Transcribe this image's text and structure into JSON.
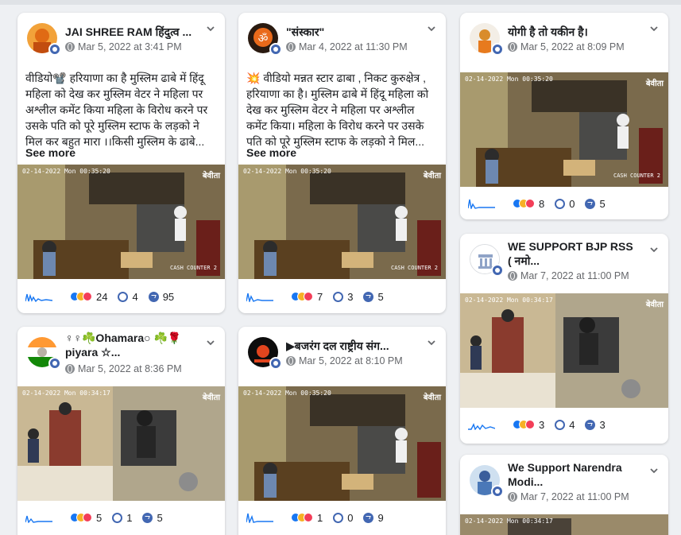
{
  "posts": [
    {
      "page_name": "JAI SHREE RAM हिंदुत्व ...",
      "date": "Mar 5, 2022 at 3:41 PM",
      "text": "वीडियो📽️ हरियाणा का है मुस्लिम ढाबे में हिंदू महिला को देख कर मुस्लिम वेटर ने महिला पर अश्लील कमेंट किया महिला के विरोध करने पर उसके पति को पूरे मुस्लिम स्टाफ के लड़को ने मिल कर बहुत मारा ।।किसी मुस्लिम के ढाबे...",
      "see_more": "See more",
      "video_timestamp": "02-14-2022 Mon 00:35:20",
      "video_watermark": "बेवीता",
      "video_counter": "CASH COUNTER 2",
      "reactions": "24",
      "comments": "4",
      "shares": "95"
    },
    {
      "page_name": "\"संस्कार\"",
      "date": "Mar 4, 2022 at 11:30 PM",
      "text": "💥 वीडियो मन्नत स्टार ढाबा , निकट कुरुक्षेत्र , हरियाणा का है। मुस्लिम ढाबे में हिंदू महिला को देख कर मुस्लिम वेटर ने महिला पर अश्लील कमेंट किया। महिला के विरोध करने पर उसके पति को पूरे मुस्लिम स्टाफ के लड़को ने मिल...",
      "see_more": "See more",
      "video_timestamp": "02-14-2022 Mon 00:35:20",
      "video_watermark": "बेवीता",
      "video_counter": "CASH COUNTER 2",
      "reactions": "7",
      "comments": "3",
      "shares": "5"
    },
    {
      "page_name": "योगी है तो यकीन है।",
      "date": "Mar 5, 2022 at 8:09 PM",
      "video_timestamp": "02-14-2022 Mon 00:35:20",
      "video_watermark": "बेवीता",
      "video_counter": "CASH COUNTER 2",
      "reactions": "8",
      "comments": "0",
      "shares": "5"
    },
    {
      "page_name": "WE SUPPORT BJP RSS ( नमो...",
      "date": "Mar 7, 2022 at 11:00 PM",
      "video_timestamp": "02-14-2022 Mon 00:34:17",
      "video_watermark": "बेवीता",
      "reactions": "3",
      "comments": "4",
      "shares": "3"
    },
    {
      "page_name": "♀♀☘️Ohamara○ ☘️🌹 piyara ☆...",
      "date": "Mar 5, 2022 at 8:36 PM",
      "video_timestamp": "02-14-2022 Mon 00:34:17",
      "video_watermark": "बेवीता",
      "reactions": "5",
      "comments": "1",
      "shares": "5"
    },
    {
      "page_name": "▶बजरंग दल राष्ट्रीय संग...",
      "date": "Mar 5, 2022 at 8:10 PM",
      "video_timestamp": "02-14-2022 Mon 00:35:20",
      "video_watermark": "बेवीता",
      "reactions": "1",
      "comments": "0",
      "shares": "9"
    },
    {
      "page_name": "We Support Narendra Modi...",
      "date": "Mar 7, 2022 at 11:00 PM",
      "video_timestamp": "02-14-2022 Mon 00:34:17"
    }
  ],
  "colors": {
    "fb_blue": "#4267b2",
    "like_blue": "#1877f2",
    "love_red": "#f33e58",
    "haha_yellow": "#f7b125",
    "meta_grey": "#65676b"
  }
}
